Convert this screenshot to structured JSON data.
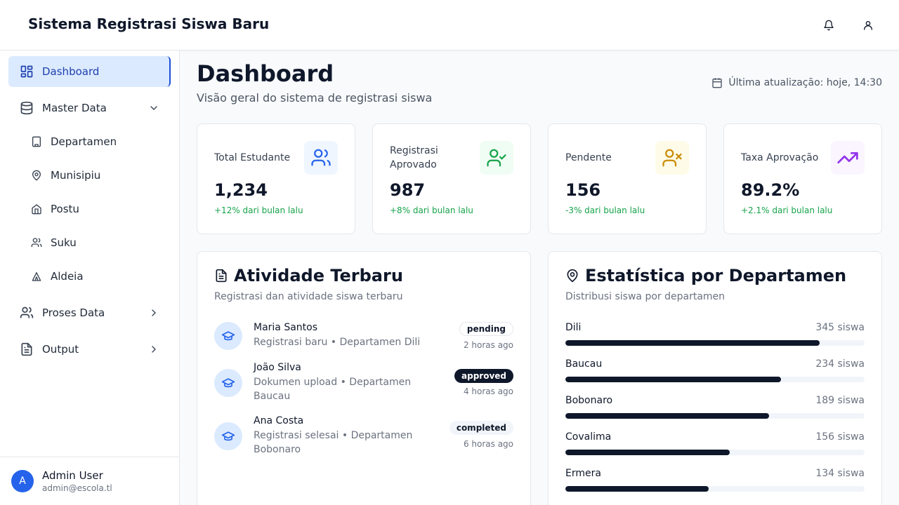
{
  "header": {
    "title": "Sistema Registrasi Siswa Baru",
    "icons": [
      "bell-icon",
      "user-icon"
    ]
  },
  "sidebar": {
    "items": [
      {
        "label": "Dashboard",
        "icon": "dashboard-icon",
        "active": true
      },
      {
        "label": "Master Data",
        "icon": "database-icon",
        "expanded": true
      },
      {
        "label": "Departamen",
        "icon": "building-icon"
      },
      {
        "label": "Munisipiu",
        "icon": "map-pin-icon"
      },
      {
        "label": "Postu",
        "icon": "home-icon"
      },
      {
        "label": "Suku",
        "icon": "users-icon"
      },
      {
        "label": "Aldeia",
        "icon": "tent-icon"
      },
      {
        "label": "Proses Data",
        "icon": "users-icon",
        "expanded": false
      },
      {
        "label": "Output",
        "icon": "file-icon",
        "expanded": false
      }
    ],
    "user": {
      "initial": "A",
      "name": "Admin User",
      "email": "admin@escola.tl"
    }
  },
  "main": {
    "title": "Dashboard",
    "subtitle": "Visão geral do sistema de registrasi siswa",
    "last_update": "Última atualização: hoje, 14:30",
    "stats": [
      {
        "label": "Total Estudante",
        "value": "1,234",
        "change": "+12% dari bulan lalu",
        "icon": "users-icon",
        "color": "#2563eb",
        "bg": "#eff6ff",
        "change_color": "#16a34a"
      },
      {
        "label": "Registrasi Aprovado",
        "value": "987",
        "change": "+8% dari bulan lalu",
        "icon": "user-check-icon",
        "color": "#16a34a",
        "bg": "#f0fdf4",
        "change_color": "#16a34a"
      },
      {
        "label": "Pendente",
        "value": "156",
        "change": "-3% dari bulan lalu",
        "icon": "user-x-icon",
        "color": "#ca8a04",
        "bg": "#fefce8",
        "change_color": "#16a34a"
      },
      {
        "label": "Taxa Aprovação",
        "value": "89.2%",
        "change": "+2.1% dari bulan lalu",
        "icon": "trending-up-icon",
        "color": "#9333ea",
        "bg": "#faf5ff",
        "change_color": "#16a34a"
      }
    ],
    "activity": {
      "title": "Atividade Terbaru",
      "subtitle": "Registrasi dan atividade siswa terbaru",
      "items": [
        {
          "name": "Maria Santos",
          "desc": "Registrasi baru • Departamen Dili",
          "status": "pending",
          "time": "2 horas ago"
        },
        {
          "name": "João Silva",
          "desc": "Dokumen upload • Departamen Baucau",
          "status": "approved",
          "time": "4 horas ago"
        },
        {
          "name": "Ana Costa",
          "desc": "Registrasi selesai • Departamen Bobonaro",
          "status": "completed",
          "time": "6 horas ago"
        }
      ]
    },
    "departments": {
      "title": "Estatística por Departamen",
      "subtitle": "Distribusi siswa por departamen",
      "max": 400,
      "items": [
        {
          "name": "Dili",
          "count": 345,
          "count_label": "345 siswa",
          "fraction": 0.85
        },
        {
          "name": "Baucau",
          "count": 234,
          "count_label": "234 siswa",
          "fraction": 0.72
        },
        {
          "name": "Bobonaro",
          "count": 189,
          "count_label": "189 siswa",
          "fraction": 0.68
        },
        {
          "name": "Covalima",
          "count": 156,
          "count_label": "156 siswa",
          "fraction": 0.55
        },
        {
          "name": "Ermera",
          "count": 134,
          "count_label": "134 siswa",
          "fraction": 0.48
        }
      ]
    }
  }
}
